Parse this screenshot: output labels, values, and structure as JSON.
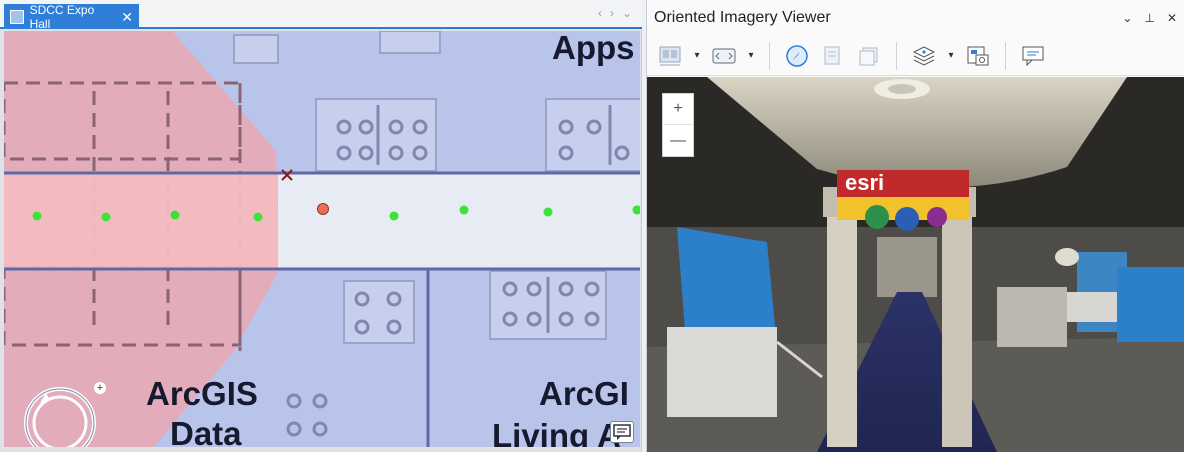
{
  "map_tab": {
    "title": "SDCC Expo Hall",
    "close_glyph": "✕"
  },
  "map_tab_nav": {
    "prev": "‹",
    "next": "›",
    "menu": "⌄"
  },
  "map_labels": {
    "apps": "Apps",
    "arcgis_left": "ArcGIS",
    "data": "Data",
    "arcgis_right": "ArcGI",
    "living": "Living A"
  },
  "nav_control": {
    "zoom_in": "+",
    "zoom_out": "−"
  },
  "viewer": {
    "title": "Oriented Imagery Viewer",
    "header_buttons": {
      "menu": "⌄",
      "pin": "⊥",
      "close": "✕"
    },
    "zoom_in": "+",
    "zoom_out": "—",
    "scene_sign": "esri"
  },
  "colors": {
    "accent": "#2f7fd8",
    "map_bg": "#b9c4ea",
    "aisle": "#eef2f4",
    "coverage": "#f3a2a8",
    "point_green": "#3ee03a",
    "point_current": "#ec6d57"
  }
}
